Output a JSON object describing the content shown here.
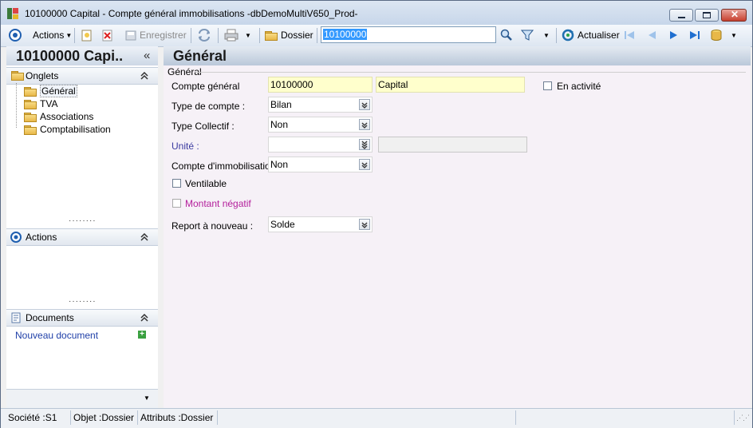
{
  "window": {
    "title": "10100000 Capital -  Compte général immobilisations -dbDemoMultiV650_Prod-"
  },
  "toolbar": {
    "actions_label": "Actions",
    "save_label": "Enregistrer",
    "dossier_label": "Dossier",
    "search_value": "10100000",
    "refresh_label": "Actualiser"
  },
  "left": {
    "header_title": "10100000 Capi..",
    "onglets_label": "Onglets",
    "tree": [
      {
        "label": "Général",
        "selected": true
      },
      {
        "label": "TVA",
        "selected": false
      },
      {
        "label": "Associations",
        "selected": false
      },
      {
        "label": "Comptabilisation",
        "selected": false
      }
    ],
    "actions_label": "Actions",
    "documents_label": "Documents",
    "new_document_label": "Nouveau document"
  },
  "main": {
    "header_title": "Général",
    "group_label": "Général",
    "fields": {
      "compte_general_label": "Compte général",
      "compte_general_value": "10100000",
      "compte_general_name": "Capital",
      "en_activite_label": "En activité",
      "type_compte_label": "Type de compte :",
      "type_compte_value": "Bilan",
      "type_collectif_label": "Type Collectif :",
      "type_collectif_value": "Non",
      "unite_label": "Unité :",
      "unite_value": "",
      "compte_immo_label": "Compte d'immobilisation :",
      "compte_immo_value": "Non",
      "ventilable_label": "Ventilable",
      "montant_negatif_label": "Montant négatif",
      "report_label": "Report à nouveau :",
      "report_value": "Solde"
    }
  },
  "status": {
    "societe": "Société :S1",
    "objet": "Objet :Dossier",
    "attributs": "Attributs :Dossier"
  },
  "colors": {
    "link_blue": "#1f3fa8",
    "unite_label": "#3a3aa0",
    "montant_negatif": "#b4209c",
    "required_yellow": "#ffffcc"
  }
}
